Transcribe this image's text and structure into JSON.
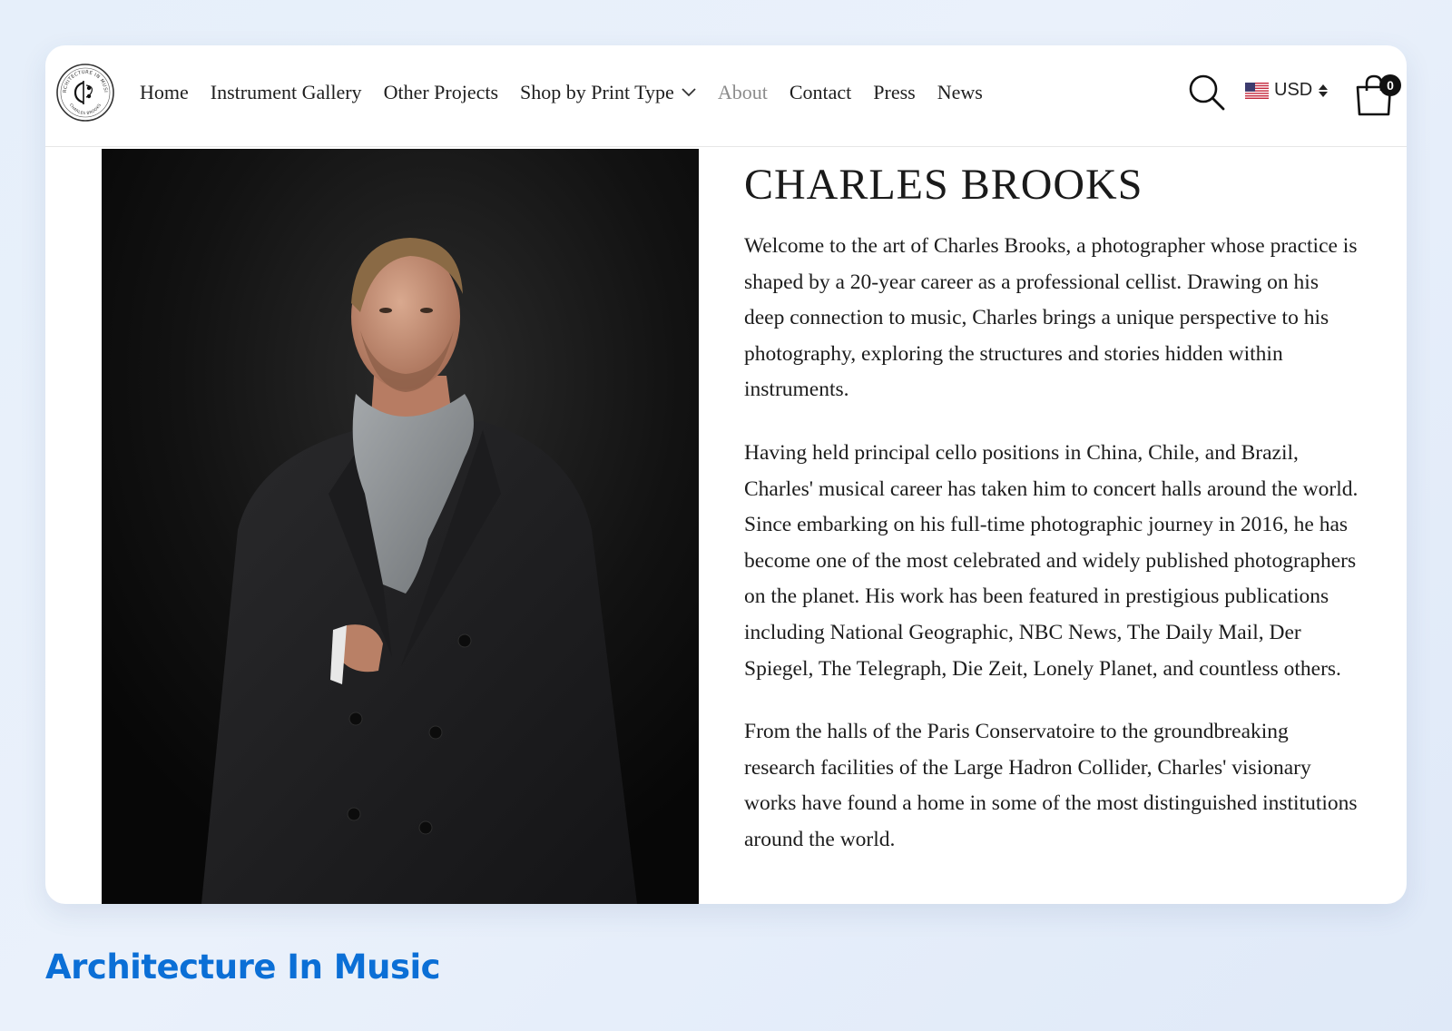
{
  "brand": {
    "logo_ring_text_top": "ARCHITECTURE IN MUSIC",
    "logo_ring_text_bottom": "CHARLES BROOKS"
  },
  "nav": {
    "items": [
      {
        "label": "Home"
      },
      {
        "label": "Instrument Gallery"
      },
      {
        "label": "Other Projects"
      },
      {
        "label": "Shop by Print Type"
      },
      {
        "label": "About"
      },
      {
        "label": "Contact"
      },
      {
        "label": "Press"
      },
      {
        "label": "News"
      }
    ],
    "active": "About"
  },
  "header_actions": {
    "search_icon": "search-icon",
    "currency": "USD",
    "cart_icon": "shopping-bag-icon",
    "cart_count": "0"
  },
  "about": {
    "title": "CHARLES BROOKS",
    "paragraphs": [
      "Welcome to the art of Charles Brooks, a photographer whose practice is shaped by a 20-year career as a professional cellist. Drawing on his deep connection to music, Charles brings a unique perspective to his photography, exploring the structures and stories hidden within instruments.",
      "Having held principal cello positions in China, Chile, and Brazil, Charles' musical career has taken him to concert halls around the world. Since embarking on his full-time photographic journey in 2016, he has become one of the most celebrated and widely published photographers on the planet. His work has been featured in prestigious publications including National Geographic, NBC News, The Daily Mail, Der Spiegel, The Telegraph, Die Zeit, Lonely Planet, and countless others.",
      "From the halls of the Paris Conservatoire to the groundbreaking research facilities of the Large Hadron Collider, Charles' visionary works have found a home in some of the most distinguished institutions around the world."
    ]
  },
  "caption": "Architecture In Music",
  "colors": {
    "caption": "#0b6fd6",
    "active_nav": "#8c8c8c",
    "text": "#1c1c1c"
  }
}
